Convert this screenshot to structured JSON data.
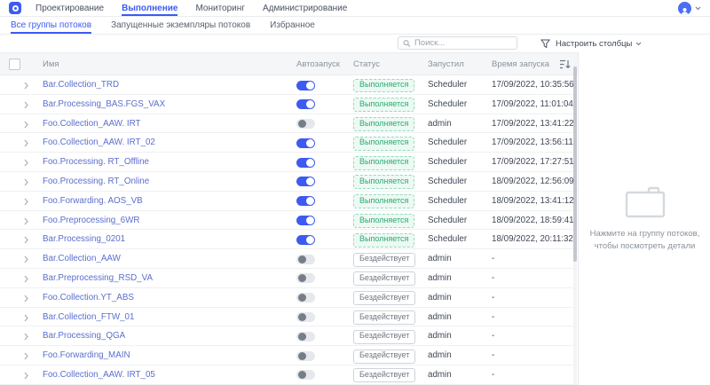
{
  "topbar": {
    "nav": [
      {
        "label": "Проектирование",
        "active": false
      },
      {
        "label": "Выполнение",
        "active": true
      },
      {
        "label": "Мониторинг",
        "active": false
      },
      {
        "label": "Администрирование",
        "active": false
      }
    ]
  },
  "tabbar": {
    "tabs": [
      {
        "label": "Все группы потоков",
        "active": true
      },
      {
        "label": "Запущенные экземпляры потоков",
        "active": false
      },
      {
        "label": "Избранное",
        "active": false
      }
    ]
  },
  "toolbar": {
    "search_placeholder": "Поиск...",
    "configure_columns_label": "Настроить столбцы"
  },
  "table": {
    "columns": {
      "name": "Имя",
      "autostart": "Автозапуск",
      "status": "Статус",
      "started_by": "Запустил",
      "start_time": "Время запуска"
    },
    "status_labels": {
      "running": "Выполняется",
      "idle": "Бездействует"
    },
    "rows": [
      {
        "name": "Bar.Collection_TRD",
        "autostart": true,
        "status": "running",
        "started_by": "Scheduler",
        "start_time": "17/09/2022, 10:35:56"
      },
      {
        "name": "Bar.Processing_BAS.FGS_VAX",
        "autostart": true,
        "status": "running",
        "started_by": "Scheduler",
        "start_time": "17/09/2022, 11:01:04"
      },
      {
        "name": "Foo.Collection_AAW. IRT",
        "autostart": false,
        "status": "running",
        "started_by": "admin",
        "start_time": "17/09/2022, 13:41:22"
      },
      {
        "name": "Foo.Collection_AAW. IRT_02",
        "autostart": true,
        "status": "running",
        "started_by": "Scheduler",
        "start_time": "17/09/2022, 13:56:11"
      },
      {
        "name": "Foo.Processing. RT_Offline",
        "autostart": true,
        "status": "running",
        "started_by": "Scheduler",
        "start_time": "17/09/2022, 17:27:51"
      },
      {
        "name": "Foo.Processing. RT_Online",
        "autostart": true,
        "status": "running",
        "started_by": "Scheduler",
        "start_time": "18/09/2022, 12:56:09"
      },
      {
        "name": "Foo.Forwarding. AOS_VB",
        "autostart": true,
        "status": "running",
        "started_by": "Scheduler",
        "start_time": "18/09/2022, 13:41:12"
      },
      {
        "name": "Foo.Preprocessing_6WR",
        "autostart": true,
        "status": "running",
        "started_by": "Scheduler",
        "start_time": "18/09/2022, 18:59:41"
      },
      {
        "name": "Bar.Processing_0201",
        "autostart": true,
        "status": "running",
        "started_by": "Scheduler",
        "start_time": "18/09/2022, 20:11:32"
      },
      {
        "name": "Bar.Collection_AAW",
        "autostart": false,
        "status": "idle",
        "started_by": "admin",
        "start_time": "-"
      },
      {
        "name": "Bar.Preprocessing_RSD_VA",
        "autostart": false,
        "status": "idle",
        "started_by": "admin",
        "start_time": "-"
      },
      {
        "name": "Foo.Collection.YT_ABS",
        "autostart": false,
        "status": "idle",
        "started_by": "admin",
        "start_time": "-"
      },
      {
        "name": "Bar.Collection_FTW_01",
        "autostart": false,
        "status": "idle",
        "started_by": "admin",
        "start_time": "-"
      },
      {
        "name": "Bar.Processing_QGA",
        "autostart": false,
        "status": "idle",
        "started_by": "admin",
        "start_time": "-"
      },
      {
        "name": "Foo.Forwarding_MAIN",
        "autostart": false,
        "status": "idle",
        "started_by": "admin",
        "start_time": "-"
      },
      {
        "name": "Foo.Collection_AAW. IRT_05",
        "autostart": false,
        "status": "idle",
        "started_by": "admin",
        "start_time": "-"
      }
    ]
  },
  "detail_panel": {
    "hint_line1": "Нажмите на группу потоков,",
    "hint_line2": "чтобы посмотреть детали"
  },
  "colors": {
    "accent": "#3d5af1",
    "link": "#5b6ece",
    "running_text": "#2bab72",
    "running_border": "#93dcbd",
    "running_bg": "#edf9f3",
    "idle_text": "#6f7782",
    "idle_border": "#cfd3da"
  }
}
